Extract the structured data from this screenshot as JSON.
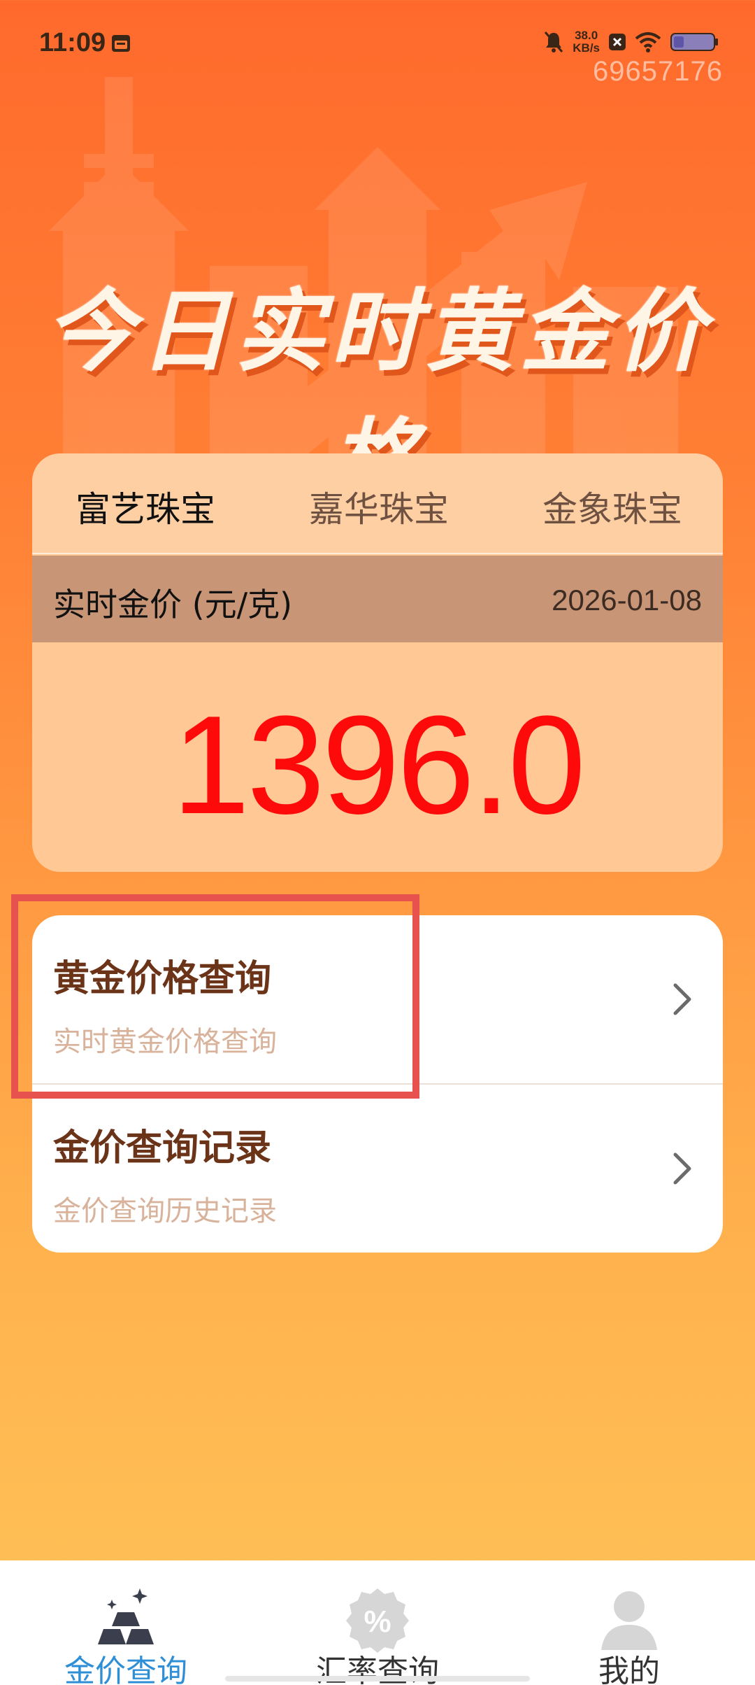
{
  "status_bar": {
    "time": "11:09",
    "network_speed_value": "38.0",
    "network_speed_unit": "KB/s",
    "watermark": "69657176",
    "icons": [
      "calendar-icon",
      "mute-bell-icon",
      "x-box-icon",
      "wifi-icon",
      "battery-icon"
    ]
  },
  "hero": {
    "title": "今日实时黄金价格"
  },
  "price_card": {
    "tabs": [
      {
        "label": "富艺珠宝",
        "active": true
      },
      {
        "label": "嘉华珠宝",
        "active": false
      },
      {
        "label": "金象珠宝",
        "active": false
      }
    ],
    "header_label": "实时金价 (元/克)",
    "date": "2026-01-08",
    "price": "1396.0"
  },
  "menu": {
    "items": [
      {
        "title": "黄金价格查询",
        "subtitle": "实时黄金价格查询"
      },
      {
        "title": "金价查询记录",
        "subtitle": "金价查询历史记录"
      }
    ]
  },
  "bottom_nav": {
    "items": [
      {
        "label": "金价查询",
        "icon": "gold-bars-icon",
        "active": true
      },
      {
        "label": "汇率查询",
        "icon": "percent-badge-icon",
        "active": false
      },
      {
        "label": "我的",
        "icon": "user-icon",
        "active": false
      }
    ]
  },
  "colors": {
    "accent_red": "#ff0a0a",
    "active_tab_blue": "#2f8fd6",
    "menu_title": "#6b3317",
    "highlight_border": "#e8524e"
  }
}
